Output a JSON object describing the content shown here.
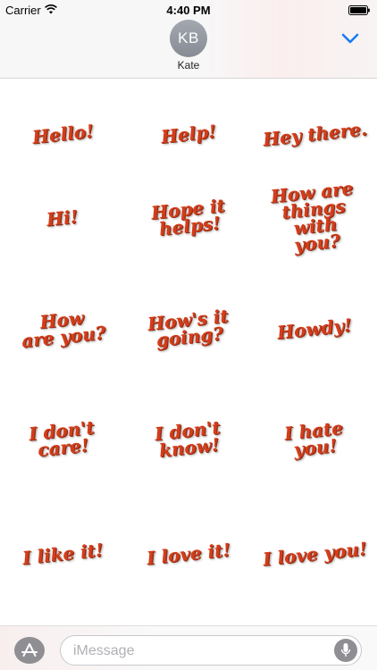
{
  "status_bar": {
    "carrier": "Carrier",
    "time": "4:40 PM"
  },
  "header": {
    "avatar_initials": "KB",
    "contact_name": "Kate",
    "accent_color": "#1a7cf5"
  },
  "stickers": [
    "Hello!",
    "Help!",
    "Hey there.",
    "Hi!",
    "Hope it\nhelps!",
    "How are\nthings with\nyou?",
    "How\nare you?",
    "How's it\ngoing?",
    "Howdy!",
    "I don't\ncare!",
    "I don't\nknow!",
    "I hate you!",
    "I like it!",
    "I love it!",
    "I love you!"
  ],
  "sticker_color": "#d43d1a",
  "input_bar": {
    "placeholder": "iMessage",
    "app_store_icon": "app-store-icon",
    "mic_icon": "microphone-icon"
  }
}
